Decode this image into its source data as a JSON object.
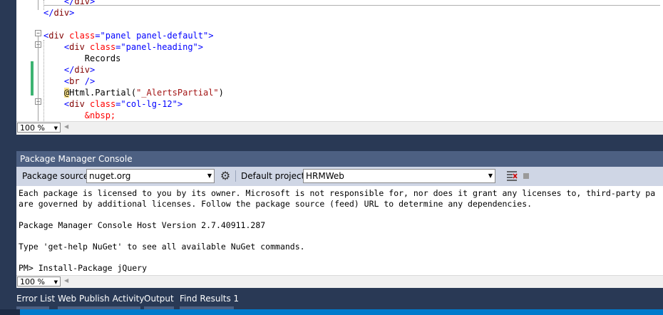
{
  "editor": {
    "lines": [
      {
        "segments": [
          {
            "cls": "t-punc",
            "text": "    </"
          },
          {
            "cls": "t-tag",
            "text": "div"
          },
          {
            "cls": "t-punc",
            "text": ">"
          }
        ]
      },
      {
        "segments": [
          {
            "cls": "t-punc",
            "text": "</"
          },
          {
            "cls": "t-tag",
            "text": "div"
          },
          {
            "cls": "t-punc",
            "text": ">"
          }
        ]
      },
      {
        "segments": []
      },
      {
        "segments": [
          {
            "cls": "t-punc",
            "text": "<"
          },
          {
            "cls": "t-tag",
            "text": "div"
          },
          {
            "cls": "t-punc",
            "text": " "
          },
          {
            "cls": "t-attr",
            "text": "class"
          },
          {
            "cls": "t-punc",
            "text": "=\"panel panel-default\">"
          }
        ]
      },
      {
        "segments": [
          {
            "cls": "t-punc",
            "text": "    <"
          },
          {
            "cls": "t-tag",
            "text": "div"
          },
          {
            "cls": "t-punc",
            "text": " "
          },
          {
            "cls": "t-attr",
            "text": "class"
          },
          {
            "cls": "t-punc",
            "text": "=\"panel-heading\">"
          }
        ]
      },
      {
        "segments": [
          {
            "cls": "t-text",
            "text": "        Records"
          }
        ]
      },
      {
        "segments": [
          {
            "cls": "t-punc",
            "text": "    </"
          },
          {
            "cls": "t-tag",
            "text": "div"
          },
          {
            "cls": "t-punc",
            "text": ">"
          }
        ]
      },
      {
        "segments": [
          {
            "cls": "t-punc",
            "text": "    <"
          },
          {
            "cls": "t-tag",
            "text": "br"
          },
          {
            "cls": "t-punc",
            "text": " />"
          }
        ]
      },
      {
        "segments": [
          {
            "cls": "t-text",
            "text": "    "
          },
          {
            "cls": "t-razor",
            "text": "@"
          },
          {
            "cls": "t-text",
            "text": "Html.Partial("
          },
          {
            "cls": "t-strlit",
            "text": "\"_AlertsPartial\""
          },
          {
            "cls": "t-text",
            "text": ")"
          }
        ]
      },
      {
        "segments": [
          {
            "cls": "t-punc",
            "text": "    <"
          },
          {
            "cls": "t-tag",
            "text": "div"
          },
          {
            "cls": "t-punc",
            "text": " "
          },
          {
            "cls": "t-attr",
            "text": "class"
          },
          {
            "cls": "t-punc",
            "text": "=\"col-lg-12\">"
          }
        ]
      },
      {
        "segments": [
          {
            "cls": "t-ent",
            "text": "        &nbsp;"
          }
        ]
      },
      {
        "segments": [
          {
            "cls": "t-punc",
            "text": "    </"
          },
          {
            "cls": "t-tag",
            "text": "div"
          },
          {
            "cls": "t-punc",
            "text": ">"
          }
        ]
      }
    ],
    "zoom": "100 %"
  },
  "package_manager": {
    "title": "Package Manager Console",
    "source_label": "Package source:",
    "source_value": "nuget.org",
    "project_label": "Default project:",
    "project_value": "HRMWeb",
    "output": [
      "Each package is licensed to you by its owner. Microsoft is not responsible for, nor does it grant any licenses to, third-party pa",
      "are governed by additional licenses. Follow the package source (feed) URL to determine any dependencies.",
      "",
      "Package Manager Console Host Version 2.7.40911.287",
      "",
      "Type 'get-help NuGet' to see all available NuGet commands.",
      "",
      "PM> Install-Package jQuery"
    ],
    "zoom": "100 %"
  },
  "bottom_tabs": [
    "Error List",
    "Web Publish Activity",
    "Output",
    "Find Results 1"
  ],
  "colors": {
    "frame": "#293955",
    "title_bar": "#4d6082",
    "toolbar": "#cfd6e5",
    "status": "#007acc",
    "change_marker": "#3cb371"
  }
}
